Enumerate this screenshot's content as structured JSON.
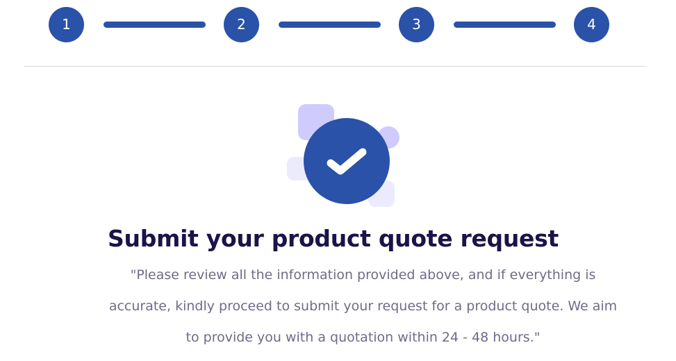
{
  "stepper": {
    "steps": [
      "1",
      "2",
      "3",
      "4"
    ]
  },
  "confirmation": {
    "title": "Submit your product quote request",
    "message_lines": [
      "\"Please review all the information provided above, and if everything is",
      "accurate, kindly proceed to submit your request for a product quote. We aim",
      "to provide you with a quotation within 24 - 48 hours.\""
    ],
    "icon": "check-circle-icon"
  },
  "colors": {
    "primary": "#2952a8",
    "title": "#1a1448",
    "body_text": "#6e6c88",
    "decor_purple": "#cfcbfd",
    "decor_light": "#ecebfd",
    "divider": "#d9d9dd"
  }
}
